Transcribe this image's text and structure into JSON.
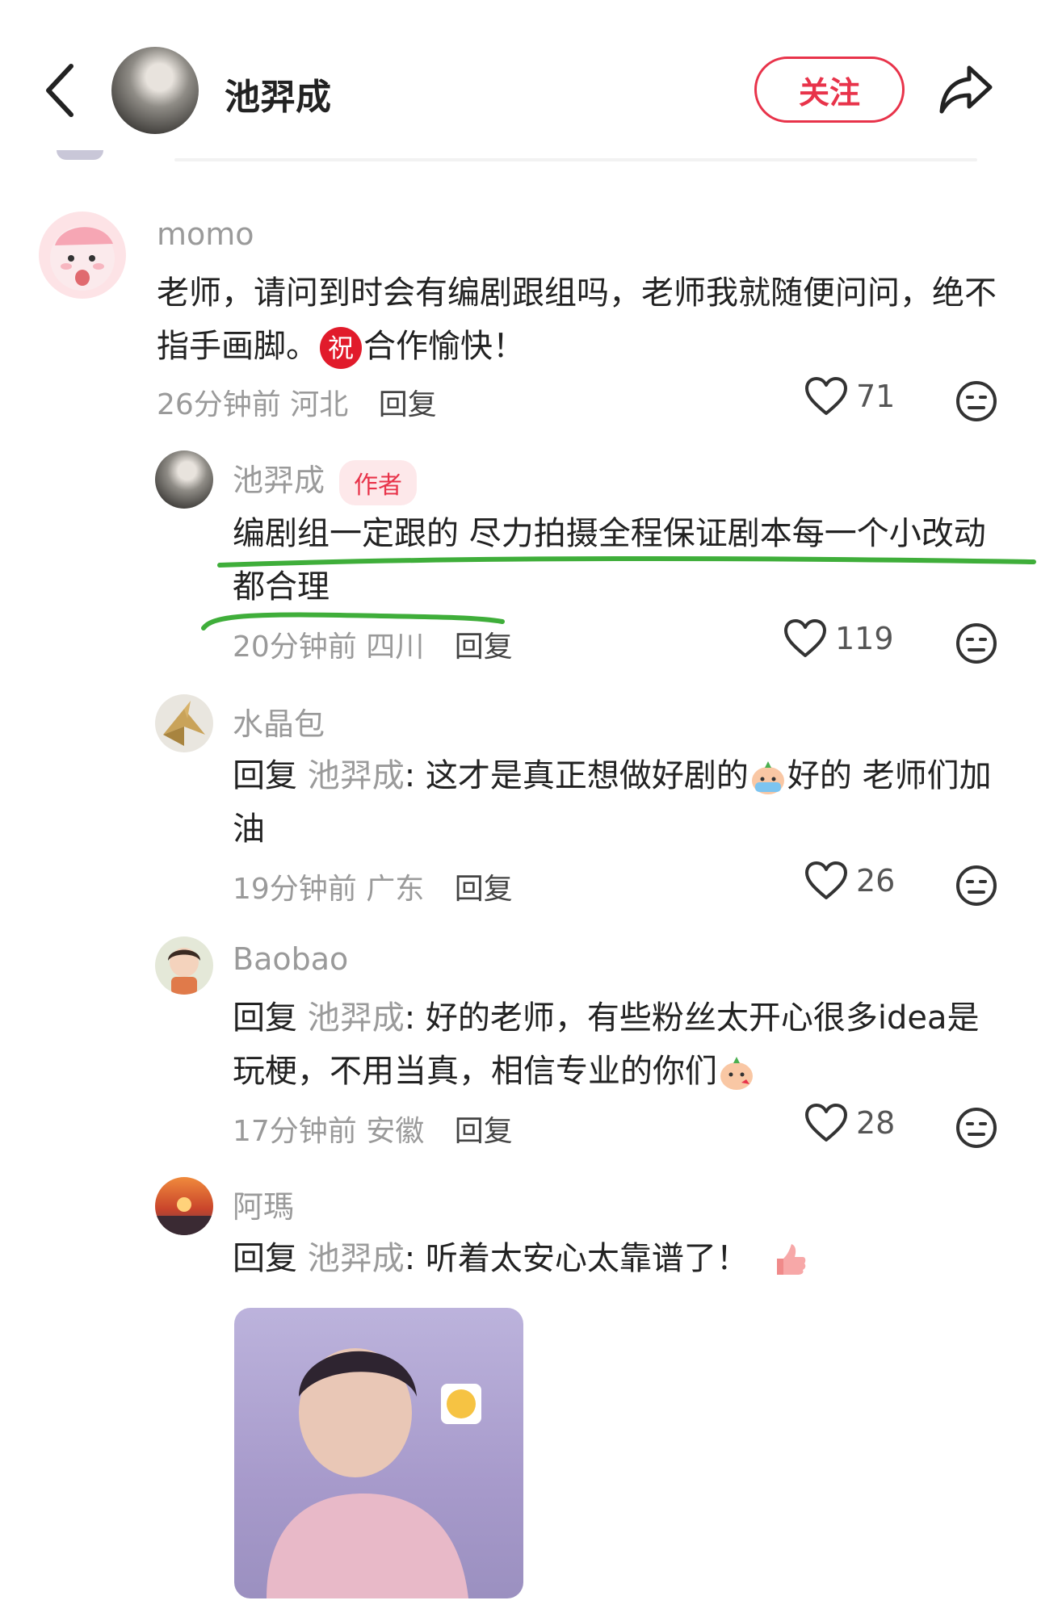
{
  "header": {
    "title": "池羿成",
    "follow_label": "关注"
  },
  "comments": [
    {
      "user": "momo",
      "text_a": "老师，请问到时会有编剧跟组吗，老师我就随便问问，绝不指手画脚。",
      "blessing": "祝",
      "text_b": "合作愉快！",
      "time": "26分钟前",
      "location": "河北",
      "reply_label": "回复",
      "likes": "71"
    },
    {
      "user": "池羿成",
      "badge": "作者",
      "text": "编剧组一定跟的 尽力拍摄全程保证剧本每一个小改动都合理",
      "time": "20分钟前",
      "location": "四川",
      "reply_label": "回复",
      "likes": "119"
    },
    {
      "user": "水晶包",
      "reply_prefix": "回复",
      "reply_to": "池羿成",
      "text_a": ": 这才是真正想做好剧的",
      "text_b": "好的 老师们加油",
      "time": "19分钟前",
      "location": "广东",
      "reply_label": "回复",
      "likes": "26"
    },
    {
      "user": "Baobao",
      "reply_prefix": "回复",
      "reply_to": "池羿成",
      "text": ": 好的老师，有些粉丝太开心很多idea是玩梗，不用当真，相信专业的你们",
      "time": "17分钟前",
      "location": "安徽",
      "reply_label": "回复",
      "likes": "28"
    },
    {
      "user": "阿瑪",
      "reply_prefix": "回复",
      "reply_to": "池羿成",
      "text": ": 听着太安心太靠谱了！"
    }
  ],
  "colors": {
    "accent": "#e8334a",
    "highlight_stroke": "#3fae3a",
    "muted_text": "#9a9a9a"
  },
  "icons": [
    "back-arrow-icon",
    "share-icon",
    "heart-icon",
    "dislike-face-icon"
  ]
}
